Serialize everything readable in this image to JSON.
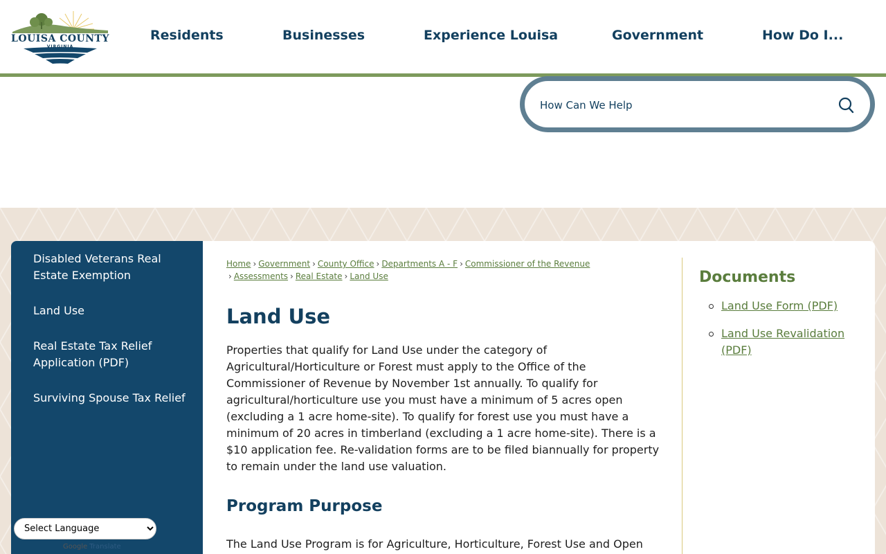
{
  "logo": {
    "name": "LOUISA COUNTY",
    "sub": "VIRGINIA"
  },
  "nav": [
    "Residents",
    "Businesses",
    "Experience Louisa",
    "Government",
    "How Do I..."
  ],
  "search": {
    "placeholder": "How Can We Help"
  },
  "sidebar": {
    "items": [
      "Disabled Veterans Real Estate Exemption",
      "Land Use",
      "Real Estate Tax Relief Application (PDF)",
      "Surviving Spouse Tax Relief"
    ]
  },
  "language": {
    "selected": "Select Language",
    "powered_by": "Google",
    "translate": "Translate"
  },
  "breadcrumb": [
    "Home",
    "Government",
    "County Office",
    "Departments A - F",
    "Commissioner of the Revenue",
    "Assessments",
    "Real Estate",
    "Land Use"
  ],
  "main": {
    "title": "Land Use",
    "intro": "Properties that qualify for Land Use under the category of Agricultural/Horticulture or Forest must apply to the Office of the Commissioner of Revenue by November 1st annually. To qualify for agricultural/horticulture use you must have a minimum of 5 acres open (excluding a 1 acre home-site). To qualify for forest use you must have a minimum of 20 acres in timberland (excluding a 1 acre home-site). There is a $10 application fee. Re-validation forms are to be filed biannually for property to remain under the land use valuation.",
    "section_title": "Program Purpose",
    "section_text": "The Land Use Program is for Agriculture, Horticulture, Forest Use and Open"
  },
  "documents": {
    "title": "Documents",
    "items": [
      "Land Use Form (PDF)",
      "Land Use Revalidation (PDF)"
    ]
  },
  "colors": {
    "navy": "#13405f",
    "sidebar": "#13476b",
    "green": "#5a7d3d",
    "rule": "#7d9a5c",
    "search_border": "#5f7f92"
  }
}
